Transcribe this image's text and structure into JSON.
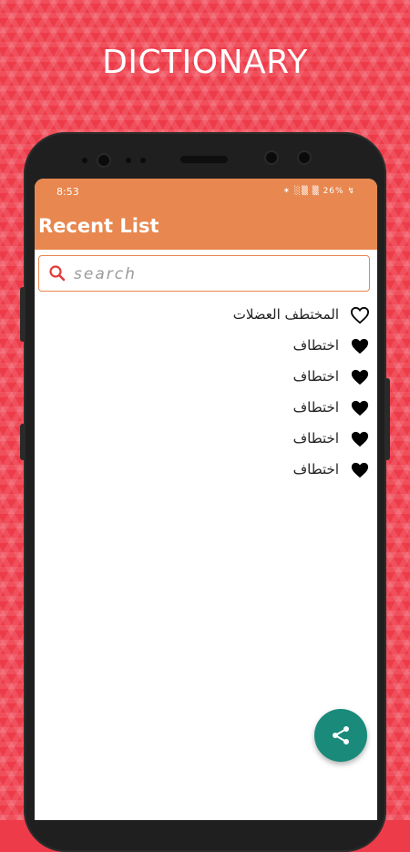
{
  "promo": {
    "title": "DICTIONARY"
  },
  "status_bar": {
    "time": "8:53",
    "battery": "26%"
  },
  "app_bar": {
    "title": "Recent List"
  },
  "search": {
    "placeholder": "search",
    "value": ""
  },
  "list": {
    "items": [
      {
        "word": "المختطف العضلات",
        "favorite": false
      },
      {
        "word": "اختطاف",
        "favorite": true
      },
      {
        "word": "اختطاف",
        "favorite": true
      },
      {
        "word": "اختطاف",
        "favorite": true
      },
      {
        "word": "اختطاف",
        "favorite": true
      },
      {
        "word": "اختطاف",
        "favorite": true
      }
    ]
  },
  "fab": {
    "icon": "share-icon"
  },
  "colors": {
    "background": "#ee3b4a",
    "appbar": "#e8874f",
    "search_border": "#e8874f",
    "fab": "#1a8a7a",
    "search_icon": "#e33b3b"
  }
}
